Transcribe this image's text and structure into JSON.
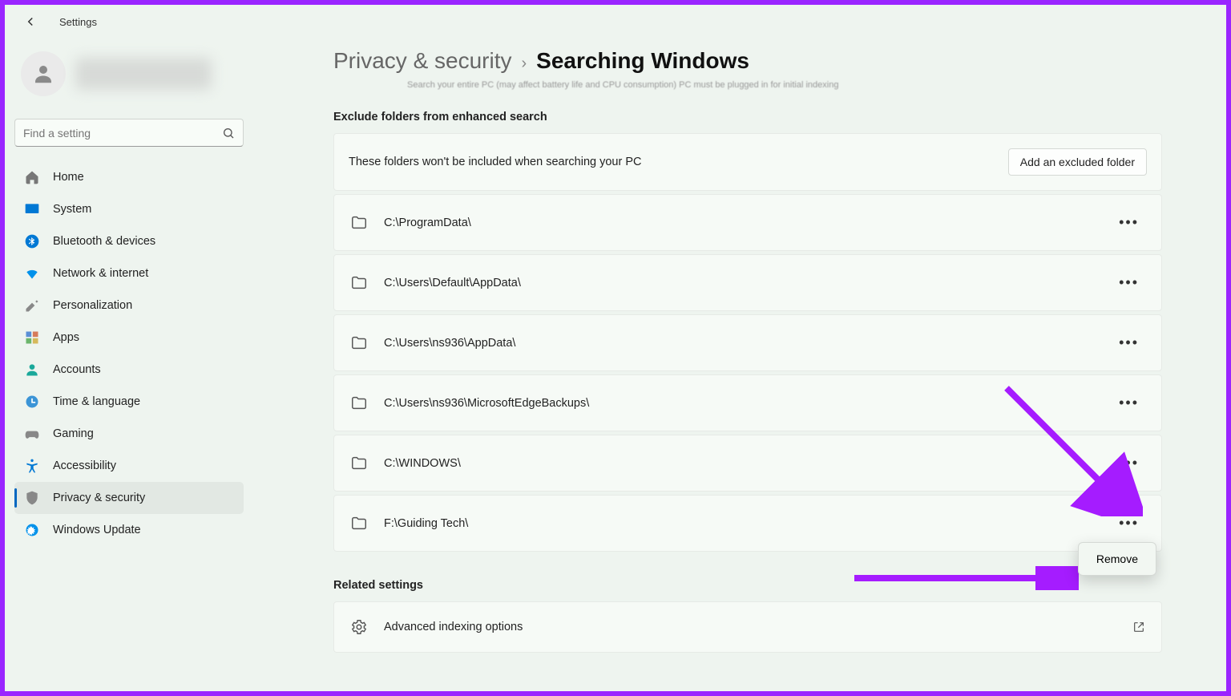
{
  "window": {
    "title": "Settings"
  },
  "search": {
    "placeholder": "Find a setting"
  },
  "sidebar": {
    "items": [
      {
        "label": "Home"
      },
      {
        "label": "System"
      },
      {
        "label": "Bluetooth & devices"
      },
      {
        "label": "Network & internet"
      },
      {
        "label": "Personalization"
      },
      {
        "label": "Apps"
      },
      {
        "label": "Accounts"
      },
      {
        "label": "Time & language"
      },
      {
        "label": "Gaming"
      },
      {
        "label": "Accessibility"
      },
      {
        "label": "Privacy & security"
      },
      {
        "label": "Windows Update"
      }
    ]
  },
  "breadcrumb": {
    "parent": "Privacy & security",
    "current": "Searching Windows"
  },
  "truncated_line": "Search your entire PC (may affect battery life and CPU consumption)   PC must be plugged in for initial indexing",
  "exclude": {
    "title": "Exclude folders from enhanced search",
    "description": "These folders won't be included when searching your PC",
    "add_label": "Add an excluded folder",
    "folders": [
      "C:\\ProgramData\\",
      "C:\\Users\\Default\\AppData\\",
      "C:\\Users\\ns936\\AppData\\",
      "C:\\Users\\ns936\\MicrosoftEdgeBackups\\",
      "C:\\WINDOWS\\",
      "F:\\Guiding Tech\\"
    ]
  },
  "popup": {
    "remove_label": "Remove"
  },
  "related": {
    "title": "Related settings",
    "advanced_label": "Advanced indexing options"
  }
}
